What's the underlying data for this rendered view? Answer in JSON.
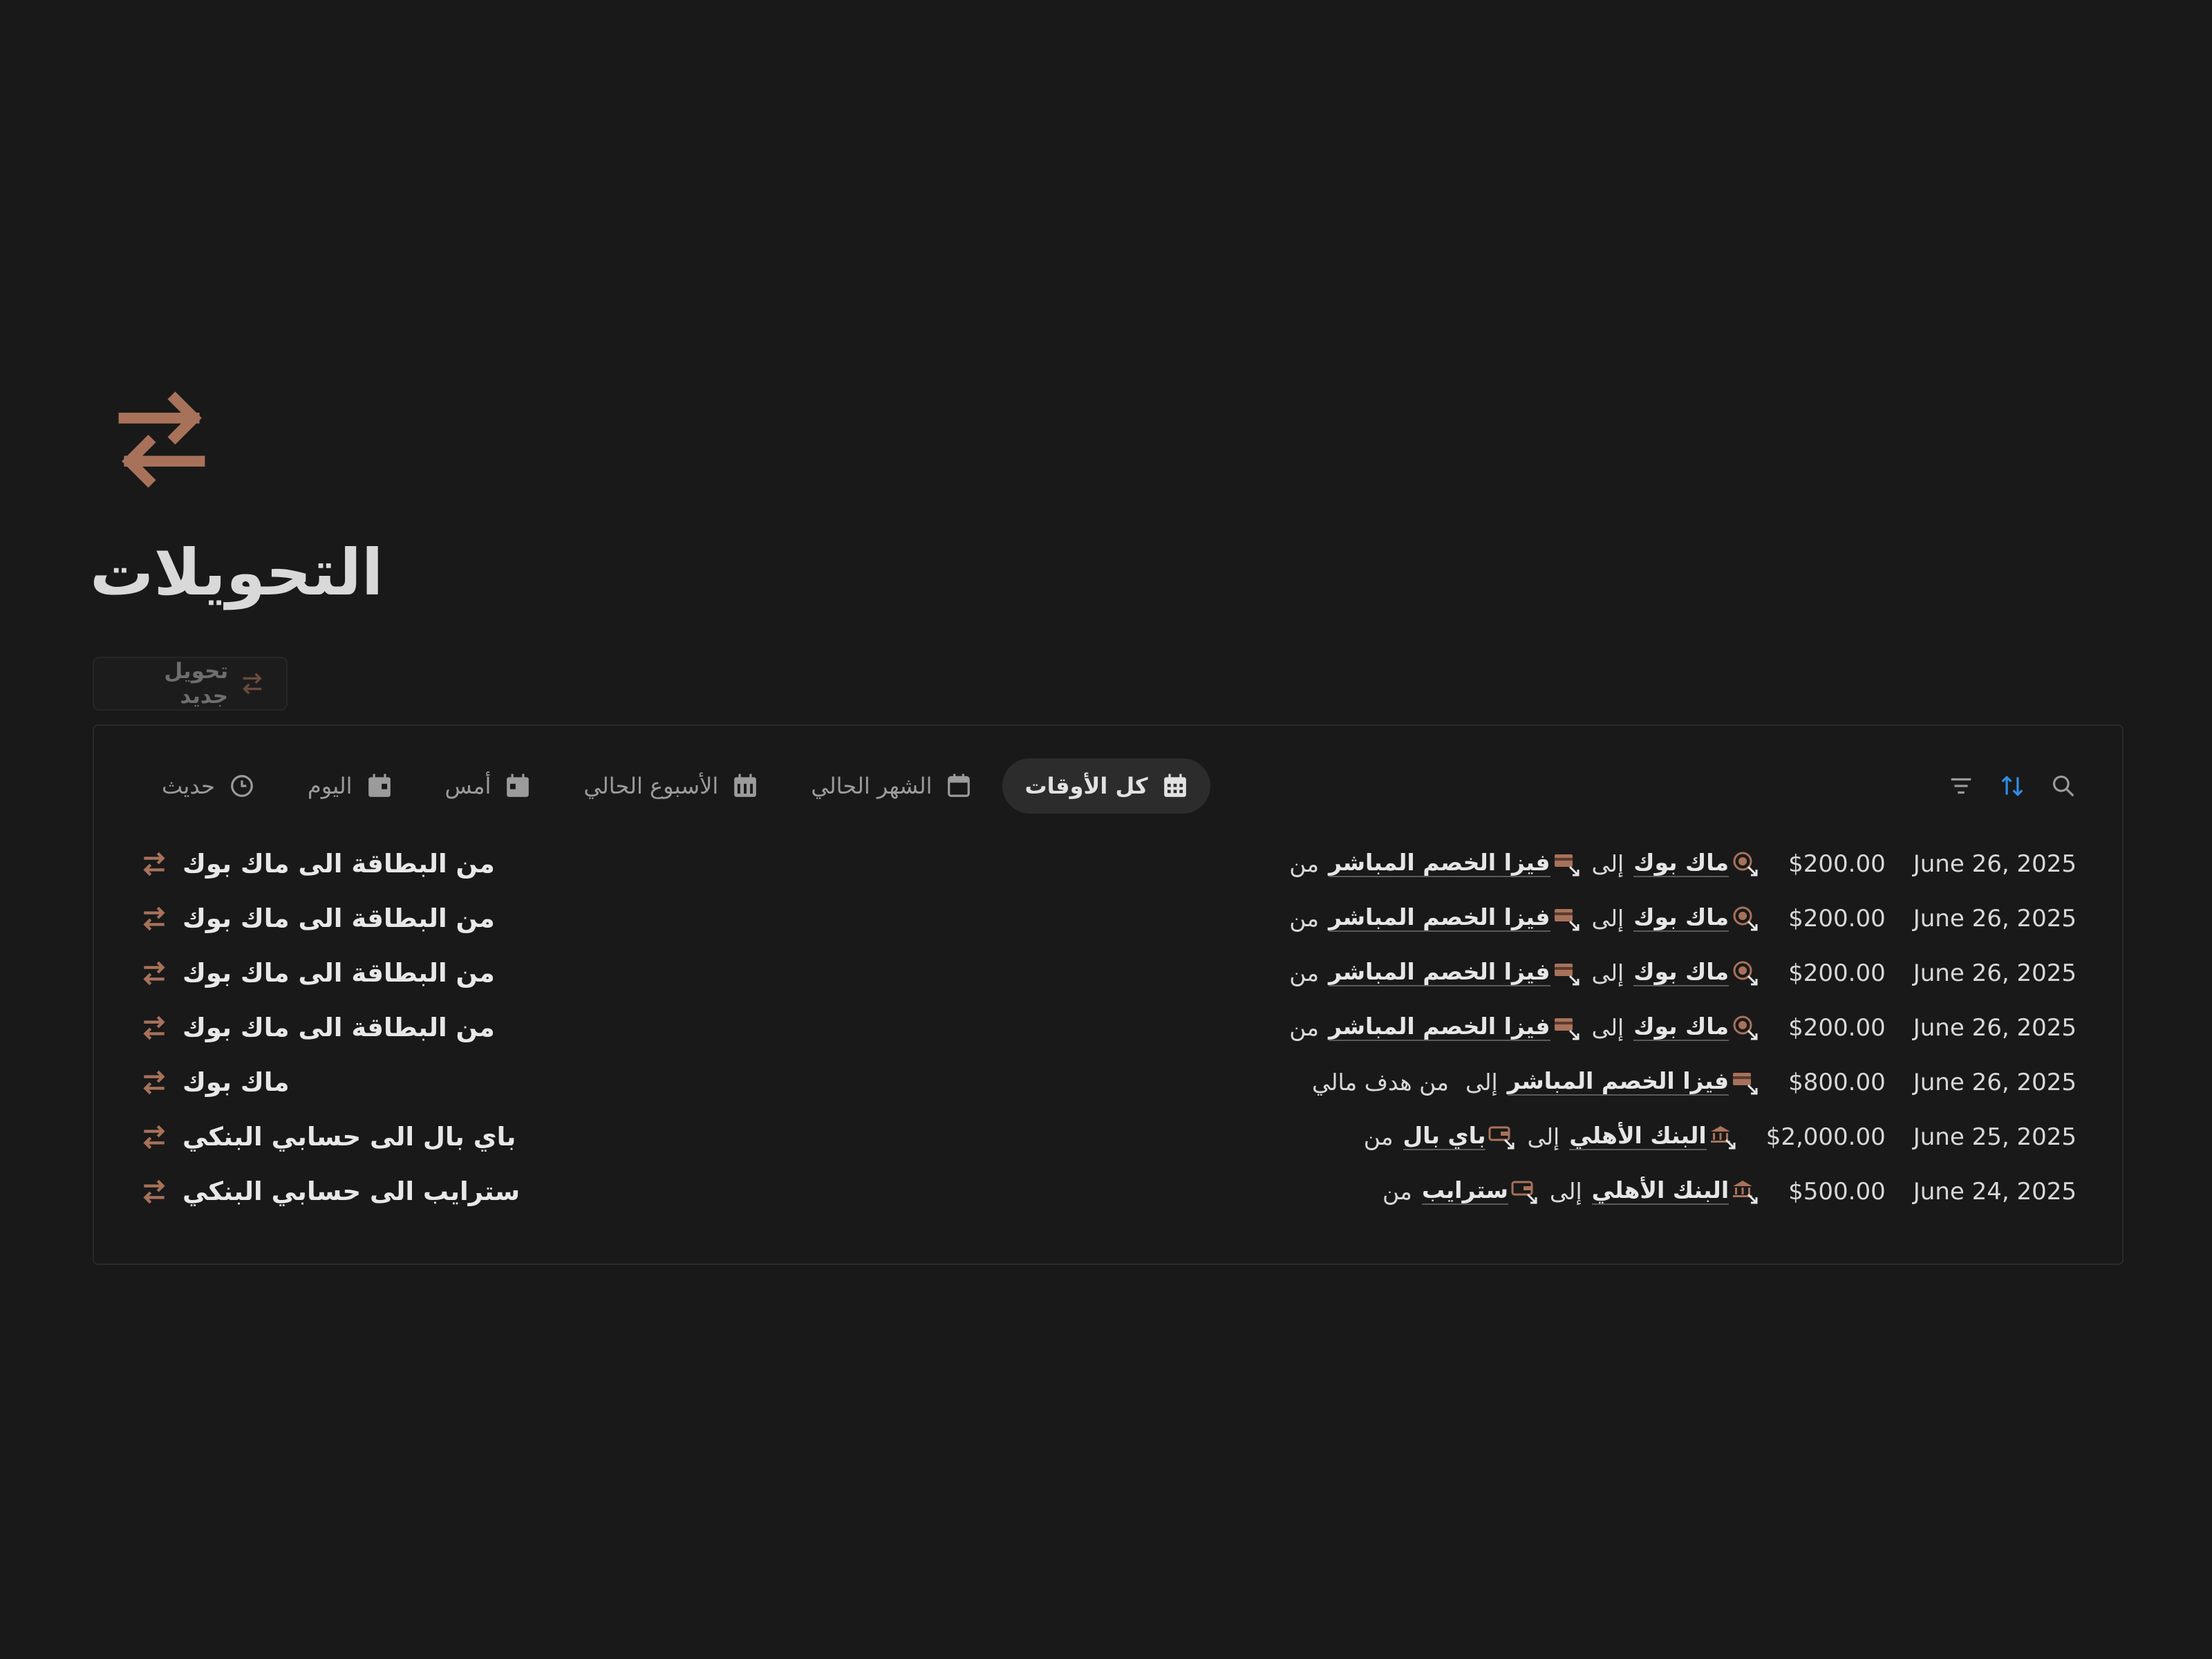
{
  "page": {
    "title": "التحويلات",
    "icon": "arrows-exchange-icon",
    "accent_color": "#a8725a"
  },
  "new_button": {
    "label": "تحويل جديد",
    "icon": "arrows-exchange-icon"
  },
  "views": [
    {
      "label": "كل الأوقات",
      "icon": "calendar-grid-icon",
      "active": true
    },
    {
      "label": "الشهر الحالي",
      "icon": "calendar-month-icon",
      "active": false
    },
    {
      "label": "الأسبوع الحالي",
      "icon": "calendar-week-icon",
      "active": false
    },
    {
      "label": "أمس",
      "icon": "calendar-day-icon",
      "active": false
    },
    {
      "label": "اليوم",
      "icon": "calendar-today-icon",
      "active": false
    },
    {
      "label": "حديث",
      "icon": "clock-icon",
      "active": false
    }
  ],
  "tools": {
    "filter_icon": "filter-icon",
    "sort_icon": "sort-icon",
    "search_icon": "search-icon",
    "sort_color": "#2f8fe6"
  },
  "rows": [
    {
      "name": "من البطاقة الى ماك بوك",
      "date": "June 26, 2025",
      "amount": "$200.00",
      "from_word": "من",
      "from": "فيزا الخصم المباشر",
      "to_word": "إلى",
      "to": "ماك بوك",
      "from_icon": "card-icon",
      "to_icon": "target-icon"
    },
    {
      "name": "من البطاقة الى ماك بوك",
      "date": "June 26, 2025",
      "amount": "$200.00",
      "from_word": "من",
      "from": "فيزا الخصم المباشر",
      "to_word": "إلى",
      "to": "ماك بوك",
      "from_icon": "card-icon",
      "to_icon": "target-icon"
    },
    {
      "name": "من البطاقة الى ماك بوك",
      "date": "June 26, 2025",
      "amount": "$200.00",
      "from_word": "من",
      "from": "فيزا الخصم المباشر",
      "to_word": "إلى",
      "to": "ماك بوك",
      "from_icon": "card-icon",
      "to_icon": "target-icon"
    },
    {
      "name": "من البطاقة الى ماك بوك",
      "date": "June 26, 2025",
      "amount": "$200.00",
      "from_word": "من",
      "from": "فيزا الخصم المباشر",
      "to_word": "إلى",
      "to": "ماك بوك",
      "from_icon": "card-icon",
      "to_icon": "target-icon"
    },
    {
      "name": "ماك بوك",
      "date": "June 26, 2025",
      "amount": "$800.00",
      "from_word": "من هدف مالي",
      "from": "",
      "to_word": "إلى",
      "to": "فيزا الخصم المباشر",
      "from_icon": "",
      "to_icon": "card-icon"
    },
    {
      "name": "باي بال الى حسابي البنكي",
      "date": "June 25, 2025",
      "amount": "$2,000.00",
      "from_word": "من",
      "from": "باي بال",
      "to_word": "إلى",
      "to": "البنك الأهلي",
      "from_icon": "wallet-icon",
      "to_icon": "bank-icon"
    },
    {
      "name": "سترايب الى حسابي البنكي",
      "date": "June 24, 2025",
      "amount": "$500.00",
      "from_word": "من",
      "from": "سترايب",
      "to_word": "إلى",
      "to": "البنك الأهلي",
      "from_icon": "wallet-icon",
      "to_icon": "bank-icon"
    }
  ]
}
